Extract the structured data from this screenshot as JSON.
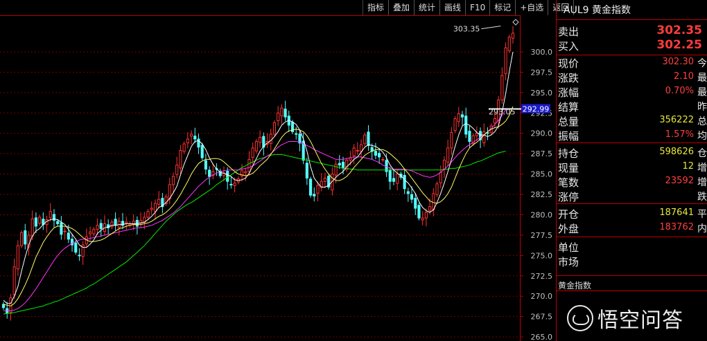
{
  "toolbar": [
    "指标",
    "叠加",
    "统计",
    "画线",
    "F10",
    "标记",
    "+自选",
    "返回"
  ],
  "quote": {
    "title": "AUL9 黄金指数",
    "sell_label": "卖出",
    "sell": "302.35",
    "buy_label": "买入",
    "buy": "302.25",
    "rows": [
      {
        "label": "现价",
        "value": "302.30",
        "trail": "今",
        "color": "red"
      },
      {
        "label": "涨跌",
        "value": "2.10",
        "trail": "最",
        "color": "red"
      },
      {
        "label": "涨幅",
        "value": "0.70%",
        "trail": "最",
        "color": "red"
      },
      {
        "label": "结算",
        "value": "",
        "trail": "昨",
        "color": "red"
      },
      {
        "label": "总量",
        "value": "356222",
        "trail": "总",
        "color": "yel"
      },
      {
        "label": "振幅",
        "value": "1.57%",
        "trail": "均",
        "color": "red"
      },
      {
        "label": "持仓",
        "value": "598626",
        "trail": "仓",
        "color": "yel"
      },
      {
        "label": "现量",
        "value": "12",
        "trail": "增",
        "color": "yel"
      },
      {
        "label": "笔数",
        "value": "23592",
        "trail": "增",
        "color": "red"
      },
      {
        "label": "涨停",
        "value": "",
        "trail": "跌",
        "color": "red"
      },
      {
        "label": "开仓",
        "value": "187641",
        "trail": "平",
        "color": "yel"
      },
      {
        "label": "外盘",
        "value": "183762",
        "trail": "内",
        "color": "red"
      },
      {
        "label": "单位",
        "value": "",
        "trail": "",
        "color": "red"
      },
      {
        "label": "市场",
        "value": "",
        "trail": "",
        "color": "red"
      }
    ],
    "sub_title": "黄金指数"
  },
  "watermark": "悟空问答",
  "chart_data": {
    "type": "candlestick",
    "ylim": [
      264.5,
      304.5
    ],
    "y_ticks": [
      "300.0",
      "297.5",
      "295.0",
      "292.5",
      "290.0",
      "287.5",
      "285.0",
      "282.5",
      "280.0",
      "277.5",
      "275.0",
      "272.5",
      "270.0",
      "267.5",
      "265.0"
    ],
    "annotations": {
      "high_label": "303.35",
      "low_label": "293.05",
      "current_price_label": "292.99",
      "current_price": 292.99
    },
    "colors": {
      "up": "#ff3232",
      "down": "#54ffff",
      "ma5": "#ffffff",
      "ma10": "#ffff66",
      "ma20": "#ff33ff",
      "ma60": "#00ee00"
    },
    "closes": [
      268.6,
      267.9,
      269.8,
      273.6,
      276.2,
      277.8,
      276.4,
      277.5,
      279.5,
      278.6,
      279.7,
      278.8,
      279.4,
      280.4,
      279.3,
      278.9,
      277.6,
      278.0,
      277.0,
      276.3,
      275.4,
      275.0,
      276.3,
      277.3,
      277.9,
      278.2,
      278.7,
      278.3,
      278.9,
      278.4,
      279.1,
      278.7,
      279.2,
      278.7,
      279.1,
      278.9,
      279.2,
      278.6,
      279.3,
      279.7,
      280.4,
      280.8,
      281.4,
      281.9,
      281.0,
      282.2,
      283.7,
      284.7,
      286.1,
      287.9,
      288.7,
      289.3,
      289.9,
      289.3,
      288.3,
      287.0,
      285.6,
      284.7,
      285.3,
      285.6,
      284.8,
      285.1,
      284.1,
      283.7,
      283.9,
      284.4,
      285.4,
      285.3,
      286.8,
      288.2,
      289.0,
      289.5,
      288.3,
      289.0,
      289.9,
      291.3,
      292.5,
      293.1,
      292.0,
      291.0,
      290.2,
      289.9,
      288.8,
      286.7,
      284.5,
      282.4,
      282.3,
      283.6,
      284.1,
      284.5,
      283.4,
      285.0,
      286.2,
      286.1,
      285.8,
      286.7,
      287.0,
      288.2,
      287.9,
      288.6,
      289.8,
      288.5,
      287.8,
      287.3,
      287.1,
      286.8,
      285.3,
      284.1,
      284.1,
      285.0,
      284.6,
      283.2,
      282.6,
      281.9,
      280.8,
      279.6,
      279.6,
      280.3,
      281.0,
      282.6,
      283.8,
      285.2,
      286.7,
      288.2,
      290.1,
      291.8,
      292.4,
      292.0,
      289.9,
      289.0,
      289.7,
      290.0,
      289.2,
      290.2,
      290.0,
      290.9,
      291.8,
      294.1,
      297.1,
      300.5,
      301.8,
      302.3
    ],
    "ma5": [
      269.5,
      269.1,
      269.1,
      270.0,
      271.2,
      273.1,
      274.8,
      276.3,
      277.4,
      278.0,
      278.3,
      278.8,
      279.2,
      279.4,
      279.5,
      279.4,
      279.1,
      278.8,
      278.2,
      277.6,
      277.0,
      276.3,
      276.0,
      276.0,
      276.4,
      276.9,
      277.7,
      278.1,
      278.4,
      278.5,
      278.7,
      278.7,
      278.8,
      278.8,
      278.9,
      278.9,
      278.9,
      278.9,
      279.0,
      279.1,
      279.4,
      279.8,
      280.3,
      280.9,
      281.1,
      281.5,
      282.0,
      282.7,
      283.5,
      284.9,
      286.2,
      287.3,
      288.4,
      289.0,
      289.1,
      288.7,
      288.0,
      287.0,
      286.2,
      285.6,
      285.2,
      285.1,
      284.9,
      284.7,
      284.3,
      284.2,
      284.3,
      284.5,
      285.1,
      286.0,
      286.9,
      287.8,
      288.4,
      288.8,
      289.1,
      289.6,
      290.2,
      291.0,
      291.4,
      291.6,
      291.4,
      291.1,
      290.4,
      289.3,
      287.8,
      285.9,
      284.5,
      283.9,
      283.4,
      283.4,
      283.6,
      284.1,
      284.6,
      285.0,
      285.3,
      285.9,
      286.3,
      286.8,
      287.1,
      287.7,
      288.3,
      288.6,
      288.5,
      288.4,
      288.1,
      287.7,
      287.0,
      286.1,
      285.5,
      285.1,
      284.8,
      284.3,
      283.9,
      283.3,
      282.6,
      281.6,
      280.9,
      280.5,
      280.3,
      280.6,
      281.5,
      282.6,
      283.9,
      285.3,
      286.8,
      288.4,
      289.8,
      290.9,
      291.2,
      291.0,
      290.6,
      290.1,
      289.8,
      289.8,
      289.6,
      289.8,
      290.2,
      290.9,
      292.6,
      294.9,
      297.6,
      300.0
    ],
    "ma10": [
      269.0,
      268.9,
      268.8,
      269.1,
      269.7,
      270.5,
      271.4,
      272.4,
      273.6,
      274.8,
      275.7,
      276.6,
      277.3,
      277.9,
      278.4,
      278.6,
      278.6,
      278.6,
      278.5,
      278.3,
      278.0,
      277.6,
      277.2,
      276.9,
      276.7,
      276.7,
      276.8,
      276.9,
      277.1,
      277.4,
      277.7,
      278.0,
      278.3,
      278.4,
      278.6,
      278.7,
      278.8,
      278.8,
      278.8,
      278.9,
      279.0,
      279.2,
      279.5,
      279.8,
      280.0,
      280.3,
      280.7,
      281.2,
      281.8,
      282.5,
      283.3,
      284.1,
      285.0,
      285.7,
      286.3,
      286.6,
      286.8,
      286.8,
      286.9,
      286.9,
      286.8,
      286.5,
      286.1,
      285.7,
      285.3,
      285.0,
      284.9,
      284.8,
      284.9,
      285.1,
      285.5,
      286.0,
      286.4,
      286.8,
      287.4,
      288.1,
      288.8,
      289.5,
      290.0,
      290.3,
      290.4,
      290.5,
      290.4,
      290.2,
      289.7,
      289.0,
      288.1,
      287.2,
      286.3,
      285.6,
      285.0,
      284.5,
      284.2,
      284.2,
      284.4,
      284.7,
      285.2,
      285.8,
      286.3,
      286.8,
      287.3,
      287.6,
      287.8,
      288.0,
      288.0,
      288.0,
      287.8,
      287.5,
      287.1,
      286.7,
      286.2,
      285.6,
      285.1,
      284.5,
      283.9,
      283.3,
      282.7,
      282.2,
      281.7,
      281.5,
      281.4,
      281.6,
      282.0,
      282.6,
      283.4,
      284.5,
      285.6,
      286.6,
      287.5,
      288.2,
      288.6,
      288.9,
      289.3,
      289.8,
      290.2,
      290.5,
      290.7,
      290.8,
      291.1,
      291.5,
      292.2,
      293.3
    ],
    "ma20": [
      268.2,
      268.2,
      268.2,
      268.3,
      268.5,
      268.8,
      269.2,
      269.7,
      270.3,
      270.9,
      271.6,
      272.3,
      273.0,
      273.7,
      274.4,
      275.0,
      275.5,
      275.9,
      276.2,
      276.5,
      276.7,
      276.9,
      277.0,
      277.0,
      277.1,
      277.2,
      277.3,
      277.4,
      277.5,
      277.6,
      277.7,
      277.8,
      277.9,
      278.0,
      278.1,
      278.2,
      278.3,
      278.4,
      278.4,
      278.5,
      278.6,
      278.7,
      278.9,
      279.1,
      279.3,
      279.6,
      279.9,
      280.2,
      280.6,
      281.0,
      281.5,
      282.0,
      282.5,
      283.0,
      283.5,
      283.9,
      284.3,
      284.6,
      284.9,
      285.1,
      285.3,
      285.4,
      285.5,
      285.5,
      285.5,
      285.5,
      285.6,
      285.7,
      285.8,
      286.0,
      286.3,
      286.6,
      286.9,
      287.2,
      287.5,
      287.9,
      288.3,
      288.6,
      288.8,
      289.0,
      289.0,
      289.0,
      288.9,
      288.7,
      288.5,
      288.3,
      288.0,
      287.8,
      287.6,
      287.4,
      287.2,
      287.0,
      286.8,
      286.8,
      286.8,
      286.9,
      287.0,
      287.1,
      287.1,
      287.1,
      287.0,
      286.9,
      286.8,
      286.6,
      286.4,
      286.1,
      285.9,
      285.7,
      285.6,
      285.6,
      285.6,
      285.6,
      285.5,
      285.4,
      285.2,
      285.0,
      284.8,
      284.7,
      284.6,
      284.7,
      284.9,
      285.2,
      285.6,
      286.0,
      286.5,
      287.0,
      287.5,
      287.9,
      288.3,
      288.6,
      288.9,
      289.2,
      289.5,
      289.8,
      290.2,
      290.6,
      291.1,
      291.6,
      292.2,
      292.9
    ],
    "ma60": [
      267.8,
      267.9,
      267.9,
      268.0,
      268.1,
      268.2,
      268.3,
      268.4,
      268.5,
      268.6,
      268.7,
      268.8,
      269.0,
      269.1,
      269.3,
      269.4,
      269.6,
      269.8,
      270.0,
      270.2,
      270.4,
      270.6,
      270.8,
      271.0,
      271.3,
      271.5,
      271.8,
      272.1,
      272.4,
      272.7,
      273.0,
      273.3,
      273.6,
      273.9,
      274.2,
      274.6,
      275.0,
      275.4,
      275.8,
      276.2,
      276.7,
      277.2,
      277.7,
      278.2,
      278.7,
      279.2,
      279.6,
      280.0,
      280.4,
      280.7,
      281.0,
      281.3,
      281.5,
      281.8,
      282.1,
      282.4,
      282.7,
      283.0,
      283.3,
      283.7,
      284.0,
      284.3,
      284.6,
      284.9,
      285.2,
      285.5,
      285.8,
      286.0,
      286.3,
      286.5,
      286.7,
      286.9,
      287.0,
      287.2,
      287.3,
      287.4,
      287.4,
      287.4,
      287.3,
      287.2,
      287.1,
      287.0,
      286.9,
      286.8,
      286.7,
      286.6,
      286.5,
      286.4,
      286.3,
      286.2,
      286.1,
      286.0,
      285.9,
      285.8,
      285.7,
      285.7,
      285.6,
      285.6,
      285.5,
      285.5,
      285.5,
      285.5,
      285.5,
      285.5,
      285.5,
      285.5,
      285.5,
      285.5,
      285.5,
      285.5,
      285.5,
      285.5,
      285.5,
      285.5,
      285.5,
      285.5,
      285.5,
      285.5,
      285.5,
      285.5,
      285.5,
      285.5,
      285.6,
      285.6,
      285.7,
      285.7,
      285.8,
      285.9,
      286.0,
      286.1,
      286.3,
      286.5,
      286.6,
      286.8,
      287.0,
      287.2,
      287.4,
      287.6,
      287.7,
      287.8
    ]
  }
}
